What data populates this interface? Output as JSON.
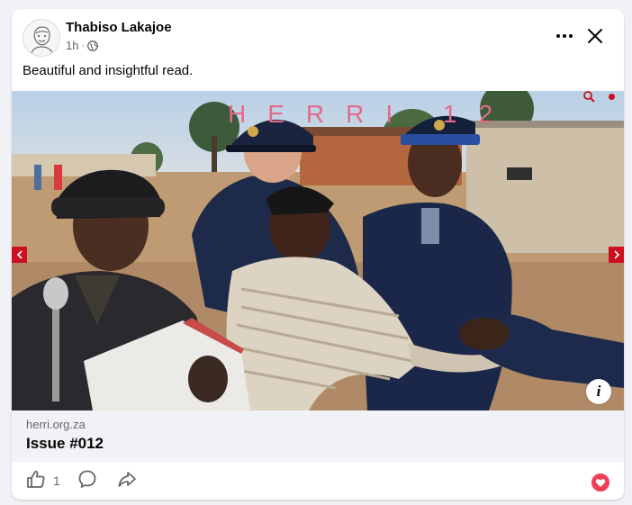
{
  "post": {
    "author": "Thabiso Lakajoe",
    "time": "1h",
    "separator": "·",
    "text": "Beautiful and insightful read.",
    "privacy_icon": "globe-icon"
  },
  "header_actions": {
    "more_icon": "more-options-icon",
    "close_icon": "close-icon"
  },
  "media": {
    "magazine_title": "HERRI 12",
    "info_label": "i"
  },
  "link": {
    "domain": "herri.org.za",
    "title": "Issue #012"
  },
  "actions": {
    "like_count": "1",
    "like_icon": "thumbs-up-icon",
    "comment_icon": "comment-icon",
    "share_icon": "share-icon",
    "reaction_icon": "love-reaction-icon"
  },
  "colors": {
    "background": "#f0f2f5",
    "card": "#ffffff",
    "secondary_text": "#65676b",
    "accent_red": "#cc1020",
    "title_pink": "#e26a8a",
    "love_reaction": "#f33e58"
  }
}
